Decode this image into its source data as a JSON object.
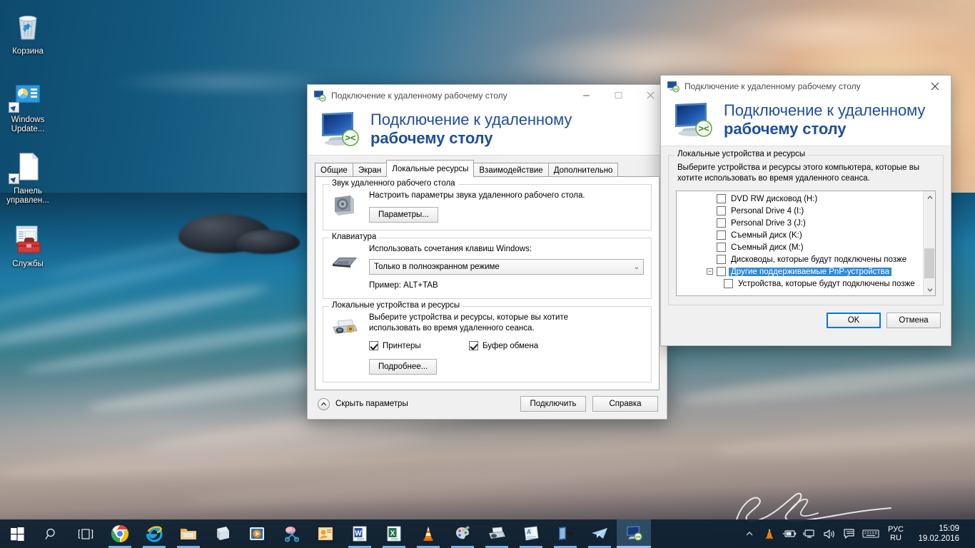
{
  "desktop": {
    "icons": [
      {
        "name": "recycle-bin",
        "label": "Корзина"
      },
      {
        "name": "windows-update",
        "label": "Windows Update..."
      },
      {
        "name": "control-panel",
        "label": "Панель управлен..."
      },
      {
        "name": "services",
        "label": "Службы"
      }
    ]
  },
  "taskbar": {
    "start_label": "Пуск",
    "search_label": "Поиск",
    "taskview_label": "Представление задач",
    "apps": [
      {
        "name": "google-chrome",
        "label": "Google Chrome",
        "state": "running"
      },
      {
        "name": "internet-explorer",
        "label": "Internet Explorer",
        "state": "running"
      },
      {
        "name": "file-explorer",
        "label": "Проводник",
        "state": "running"
      },
      {
        "name": "store",
        "label": "Магазин",
        "state": "pinned"
      },
      {
        "name": "media-player",
        "label": "Проигрыватель",
        "state": "pinned"
      },
      {
        "name": "snipping-tool",
        "label": "Ножницы",
        "state": "pinned"
      },
      {
        "name": "outlook",
        "label": "Outlook",
        "state": "pinned"
      },
      {
        "name": "word",
        "label": "Word",
        "state": "running"
      },
      {
        "name": "excel",
        "label": "Excel",
        "state": "running"
      },
      {
        "name": "vlc",
        "label": "VLC",
        "state": "running"
      },
      {
        "name": "paint",
        "label": "Paint",
        "state": "running"
      },
      {
        "name": "printer",
        "label": "Принтер",
        "state": "running"
      },
      {
        "name": "notepad",
        "label": "Блокнот",
        "state": "running"
      },
      {
        "name": "remote-app",
        "label": "Удаленное приложение",
        "state": "running"
      },
      {
        "name": "telegram",
        "label": "Telegram",
        "state": "running"
      },
      {
        "name": "remote-desktop",
        "label": "Подключение к удаленному рабочему столу",
        "state": "active"
      }
    ],
    "tray": {
      "overflow_label": "Отображать скрытые значки",
      "icons": [
        {
          "name": "vlc-tray-icon",
          "label": "VLC"
        },
        {
          "name": "battery-icon",
          "label": "Батарея"
        },
        {
          "name": "network-icon",
          "label": "Сеть"
        },
        {
          "name": "volume-icon",
          "label": "Громкость"
        },
        {
          "name": "action-center-icon",
          "label": "Центр уведомлений"
        },
        {
          "name": "touch-keyboard-icon",
          "label": "Сенсорная клавиатура"
        }
      ],
      "language_line1": "РУС",
      "language_line2": "RU",
      "clock_time": "15:09",
      "clock_date": "19.02.2016"
    }
  },
  "main_window": {
    "title": "Подключение к удаленному рабочему столу",
    "header_line1": "Подключение к удаленному",
    "header_line2": "рабочему столу",
    "controls": {
      "minimize": "—",
      "maximize": "□",
      "close": "✕"
    },
    "tabs": [
      {
        "label": "Общие",
        "selected": false
      },
      {
        "label": "Экран",
        "selected": false
      },
      {
        "label": "Локальные ресурсы",
        "selected": true
      },
      {
        "label": "Взаимодействие",
        "selected": false
      },
      {
        "label": "Дополнительно",
        "selected": false
      }
    ],
    "groups": {
      "audio": {
        "legend": "Звук удаленного рабочего стола",
        "description": "Настроить параметры звука удаленного рабочего стола.",
        "button": "Параметры..."
      },
      "keyboard": {
        "legend": "Клавиатура",
        "description": "Использовать сочетания клавиш Windows:",
        "combo_value": "Только в полноэкранном режиме",
        "example": "Пример: ALT+TAB"
      },
      "devices": {
        "legend": "Локальные устройства и ресурсы",
        "description_line1": "Выберите устройства и ресурсы, которые вы хотите",
        "description_line2": "использовать во время удаленного сеанса.",
        "checkboxes": [
          {
            "label": "Принтеры",
            "checked": true
          },
          {
            "label": "Буфер обмена",
            "checked": true
          }
        ],
        "button": "Подробнее..."
      }
    },
    "footer": {
      "hide_params": "Скрыть параметры",
      "connect": "Подключить",
      "help": "Справка"
    }
  },
  "devices_dialog": {
    "title": "Подключение к удаленному рабочему столу",
    "header_line1": "Подключение к удаленному",
    "header_line2": "рабочему столу",
    "close_label": "✕",
    "group_legend": "Локальные устройства и ресурсы",
    "description_line1": "Выберите устройства и ресурсы этого компьютера, которые вы",
    "description_line2": "хотите использовать во время удаленного сеанса.",
    "list": [
      {
        "label": "DVD RW дисковод (H:)",
        "checked": false,
        "level": "child",
        "selected": false,
        "expander": false
      },
      {
        "label": "Personal Drive 4 (I:)",
        "checked": false,
        "level": "child",
        "selected": false,
        "expander": false
      },
      {
        "label": "Personal Drive 3 (J:)",
        "checked": false,
        "level": "child",
        "selected": false,
        "expander": false
      },
      {
        "label": "Съемный диск (K:)",
        "checked": false,
        "level": "child",
        "selected": false,
        "expander": false
      },
      {
        "label": "Съемный диск (M:)",
        "checked": false,
        "level": "child",
        "selected": false,
        "expander": false
      },
      {
        "label": "Дисководы, которые будут подключены позже",
        "checked": false,
        "level": "child",
        "selected": false,
        "expander": false
      },
      {
        "label": "Другие поддерживаемые PnP-устройства",
        "checked": false,
        "level": "root",
        "selected": true,
        "expander": true
      },
      {
        "label": "Устройства, которые будут подключены позже",
        "checked": false,
        "level": "child",
        "selected": false,
        "expander": false
      }
    ],
    "scroll_up": "⌃",
    "scroll_down": "⌄",
    "buttons": {
      "ok": "OK",
      "cancel": "Отмена"
    }
  },
  "colors": {
    "accent": "#1f4e9c",
    "selection": "#2f8ad8",
    "taskbar": "#0e2030",
    "default_button_border": "#0078d7"
  }
}
